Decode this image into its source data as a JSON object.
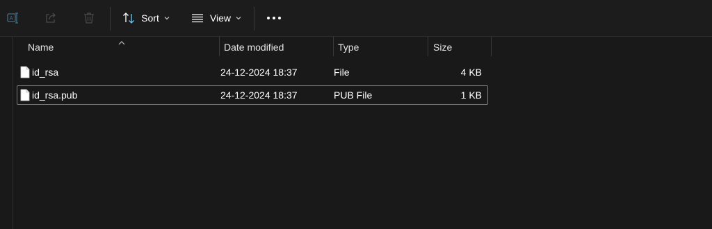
{
  "toolbar": {
    "sort_label": "Sort",
    "view_label": "View",
    "more_label": "•••"
  },
  "columns": {
    "name": "Name",
    "date_modified": "Date modified",
    "type": "Type",
    "size": "Size"
  },
  "files": [
    {
      "name": "id_rsa",
      "date_modified": "24-12-2024 18:37",
      "type": "File",
      "size": "4 KB",
      "focused": false
    },
    {
      "name": "id_rsa.pub",
      "date_modified": "24-12-2024 18:37",
      "type": "PUB File",
      "size": "1 KB",
      "focused": true
    }
  ],
  "colors": {
    "background": "#191919",
    "toolbar": "#1c1c1c",
    "accent": "#60cdff",
    "focus_border": "#7a7a7a"
  },
  "icons": {
    "toolbar": [
      "rename-icon",
      "share-icon",
      "delete-icon",
      "sort-icon",
      "chevron-down-icon",
      "view-icon",
      "chevron-down-icon",
      "more-icon"
    ],
    "file": "file-icon",
    "sort_indicator": "sort-ascending-icon"
  }
}
